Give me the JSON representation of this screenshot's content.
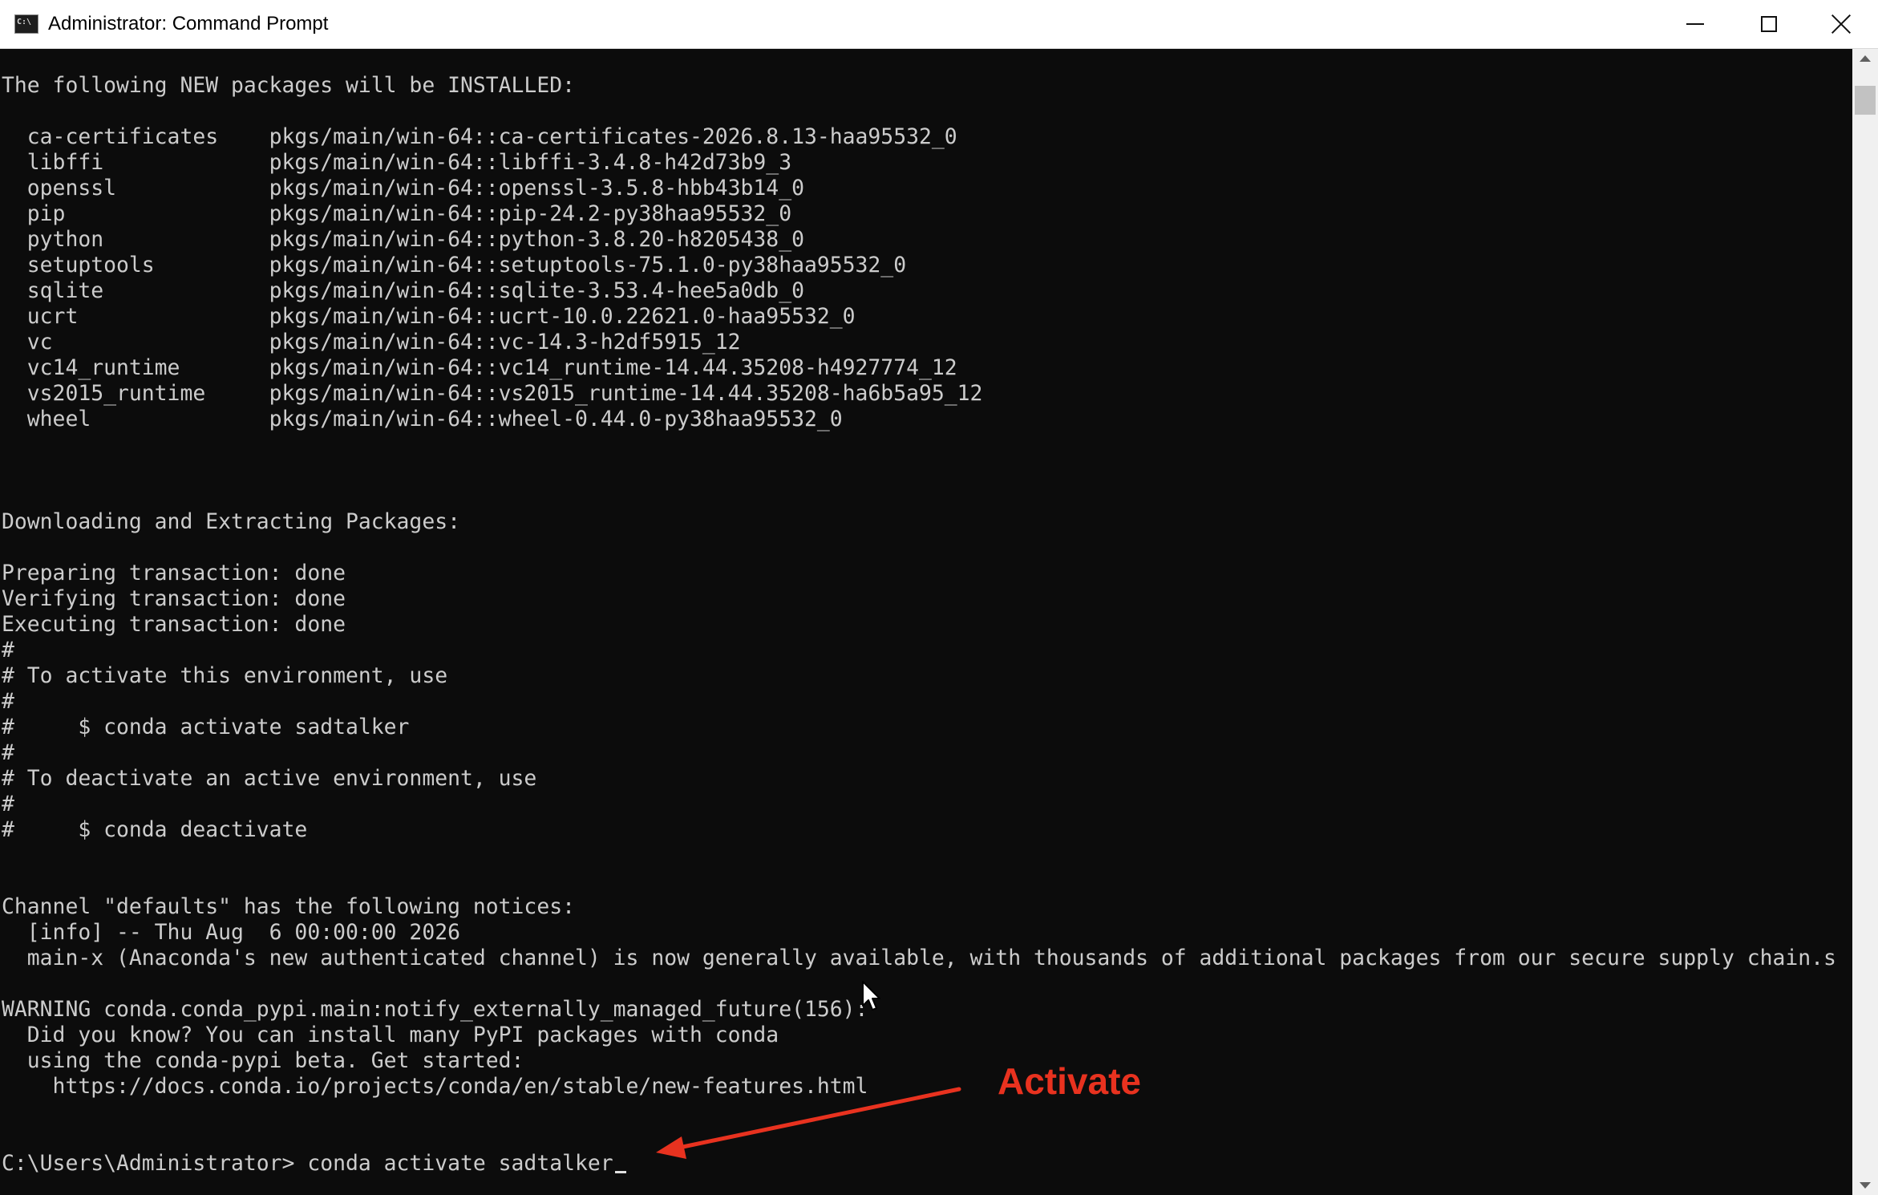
{
  "window": {
    "title": "Administrator: Command Prompt",
    "icon": "cmd-icon",
    "controls": [
      "minimize-icon",
      "maximize-icon",
      "close-icon"
    ]
  },
  "console": {
    "lines": [
      "The following NEW packages will be INSTALLED:",
      "",
      "  ca-certificates    pkgs/main/win-64::ca-certificates-2026.8.13-haa95532_0",
      "  libffi             pkgs/main/win-64::libffi-3.4.8-h42d73b9_3",
      "  openssl            pkgs/main/win-64::openssl-3.5.8-hbb43b14_0",
      "  pip                pkgs/main/win-64::pip-24.2-py38haa95532_0",
      "  python             pkgs/main/win-64::python-3.8.20-h8205438_0",
      "  setuptools         pkgs/main/win-64::setuptools-75.1.0-py38haa95532_0",
      "  sqlite             pkgs/main/win-64::sqlite-3.53.4-hee5a0db_0",
      "  ucrt               pkgs/main/win-64::ucrt-10.0.22621.0-haa95532_0",
      "  vc                 pkgs/main/win-64::vc-14.3-h2df5915_12",
      "  vc14_runtime       pkgs/main/win-64::vc14_runtime-14.44.35208-h4927774_12",
      "  vs2015_runtime     pkgs/main/win-64::vs2015_runtime-14.44.35208-ha6b5a95_12",
      "  wheel              pkgs/main/win-64::wheel-0.44.0-py38haa95532_0",
      "",
      "",
      "",
      "Downloading and Extracting Packages:",
      "",
      "Preparing transaction: done",
      "Verifying transaction: done",
      "Executing transaction: done",
      "#",
      "# To activate this environment, use",
      "#",
      "#     $ conda activate sadtalker",
      "#",
      "# To deactivate an active environment, use",
      "#",
      "#     $ conda deactivate",
      "",
      "",
      "Channel \"defaults\" has the following notices:",
      "  [info] -- Thu Aug  6 00:00:00 2026",
      "  main-x (Anaconda's new authenticated channel) is now generally available, with thousands of additional packages from our secure supply chain.s",
      "",
      "WARNING conda.conda_pypi.main:notify_externally_managed_future(156):",
      "  Did you know? You can install many PyPI packages with conda",
      "  using the conda-pypi beta. Get started:",
      "    https://docs.conda.io/projects/conda/en/stable/new-features.html",
      "",
      ""
    ],
    "prompt_path": "C:\\Users\\Administrator>",
    "prompt_command": " conda activate sadtalker",
    "text_color": "#cccccc",
    "background_color": "#0c0c0c"
  },
  "annotation": {
    "label": "Activate",
    "color": "#e8321f"
  },
  "scrollbar": {
    "up_icon": "scroll-up-arrow-icon",
    "down_icon": "scroll-down-arrow-icon"
  }
}
